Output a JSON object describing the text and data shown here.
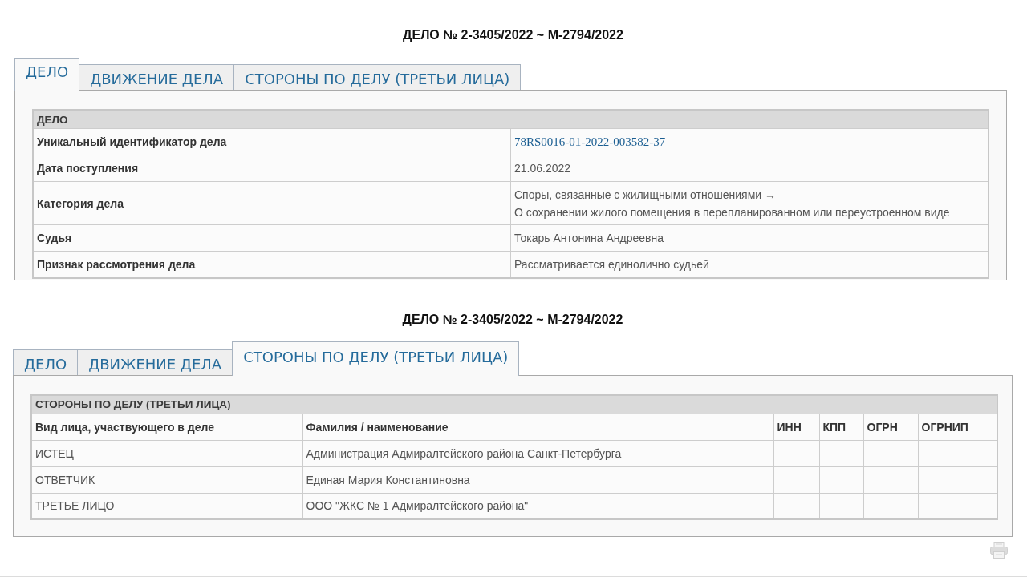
{
  "sections": [
    {
      "title": "ДЕЛО № 2-3405/2022 ~ М-2794/2022",
      "tabs": [
        {
          "label": "ДЕЛО",
          "selected": true
        },
        {
          "label": "ДВИЖЕНИЕ ДЕЛА",
          "selected": false
        },
        {
          "label": "СТОРОНЫ ПО ДЕЛУ (ТРЕТЬИ ЛИЦА)",
          "selected": false
        }
      ],
      "table": {
        "kind": "fields",
        "caption": "ДЕЛО",
        "rows": [
          {
            "label": "Уникальный идентификатор дела",
            "kind": "link",
            "lines": [
              "78RS0016-01-2022-003582-37"
            ]
          },
          {
            "label": "Дата поступления",
            "kind": "text",
            "lines": [
              "21.06.2022"
            ]
          },
          {
            "label": "Категория дела",
            "kind": "text",
            "lines": [
              "Споры, связанные с жилищными отношениями →",
              "О сохранении жилого помещения в перепланированном или переустроенном виде"
            ]
          },
          {
            "label": "Судья",
            "kind": "text",
            "lines": [
              "Токарь Антонина Андреевна"
            ]
          },
          {
            "label": "Признак рассмотрения дела",
            "kind": "text",
            "lines": [
              "Рассматривается единолично судьей"
            ]
          }
        ]
      }
    },
    {
      "title": "ДЕЛО № 2-3405/2022 ~ М-2794/2022",
      "tabs": [
        {
          "label": "ДЕЛО",
          "selected": false
        },
        {
          "label": "ДВИЖЕНИЕ ДЕЛА",
          "selected": false
        },
        {
          "label": "СТОРОНЫ ПО ДЕЛУ (ТРЕТЬИ ЛИЦА)",
          "selected": true
        }
      ],
      "table": {
        "kind": "grid",
        "caption": "СТОРОНЫ ПО ДЕЛУ (ТРЕТЬИ ЛИЦА)",
        "columns": [
          "Вид лица, участвующего в деле",
          "Фамилия / наименование",
          "ИНН",
          "КПП",
          "ОГРН",
          "ОГРНИП"
        ],
        "rows": [
          {
            "cells": [
              "ИСТЕЦ",
              "Администрация Адмиралтейского района Санкт-Петербурга"
            ]
          },
          {
            "cells": [
              "ОТВЕТЧИК",
              "Единая Мария Константиновна"
            ]
          },
          {
            "cells": [
              "ТРЕТЬЕ ЛИЦО",
              "ООО \"ЖКС № 1 Адмиралтейского района\""
            ]
          }
        ]
      }
    }
  ]
}
